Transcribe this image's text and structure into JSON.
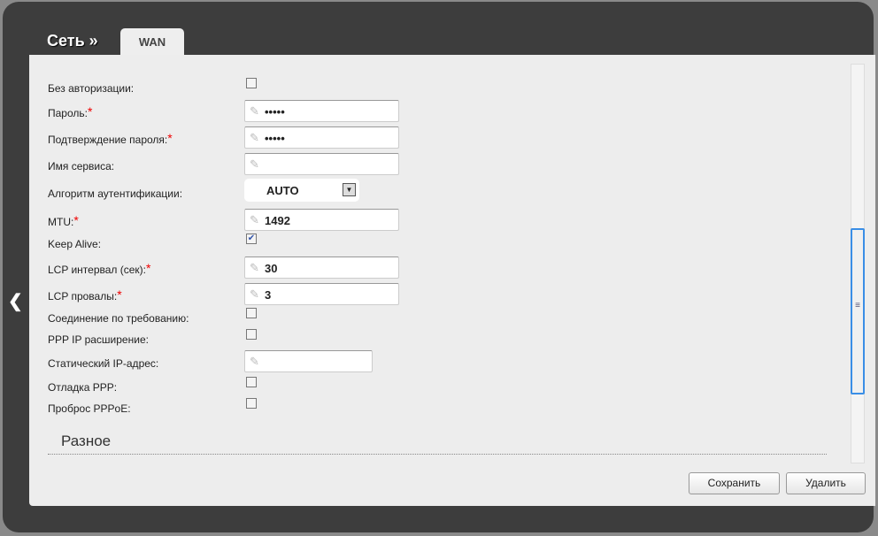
{
  "header": {
    "title": "Сеть »",
    "tab": "WAN"
  },
  "fields": [
    {
      "label": "Без авторизации:",
      "type": "checkbox",
      "checked": false
    },
    {
      "label": "Пароль:",
      "required": true,
      "type": "text",
      "value": "•••••"
    },
    {
      "label": "Подтверждение пароля:",
      "required": true,
      "type": "text",
      "value": "•••••"
    },
    {
      "label": "Имя сервиса:",
      "type": "text",
      "value": ""
    },
    {
      "label": "Алгоритм аутентификации:",
      "type": "select",
      "value": "AUTO"
    },
    {
      "label": "MTU:",
      "required": true,
      "type": "text",
      "value": "1492"
    },
    {
      "label": "Keep Alive:",
      "type": "checkbox",
      "checked": true
    },
    {
      "label": "LCP интервал (сек):",
      "required": true,
      "type": "text",
      "value": "30"
    },
    {
      "label": "LCP провалы:",
      "required": true,
      "type": "text",
      "value": "3"
    },
    {
      "label": "Соединение по требованию:",
      "type": "checkbox",
      "checked": false
    },
    {
      "label": "PPP IP расширение:",
      "type": "checkbox",
      "checked": false
    },
    {
      "label": "Статический IP-адрес:",
      "type": "text",
      "value": ""
    },
    {
      "label": "Отладка PPP:",
      "type": "checkbox",
      "checked": false
    },
    {
      "label": "Проброс PPPoE:",
      "type": "checkbox",
      "checked": false
    }
  ],
  "section": "Разное",
  "required_mark": "*",
  "buttons": {
    "save": "Сохранить",
    "delete": "Удалить"
  }
}
